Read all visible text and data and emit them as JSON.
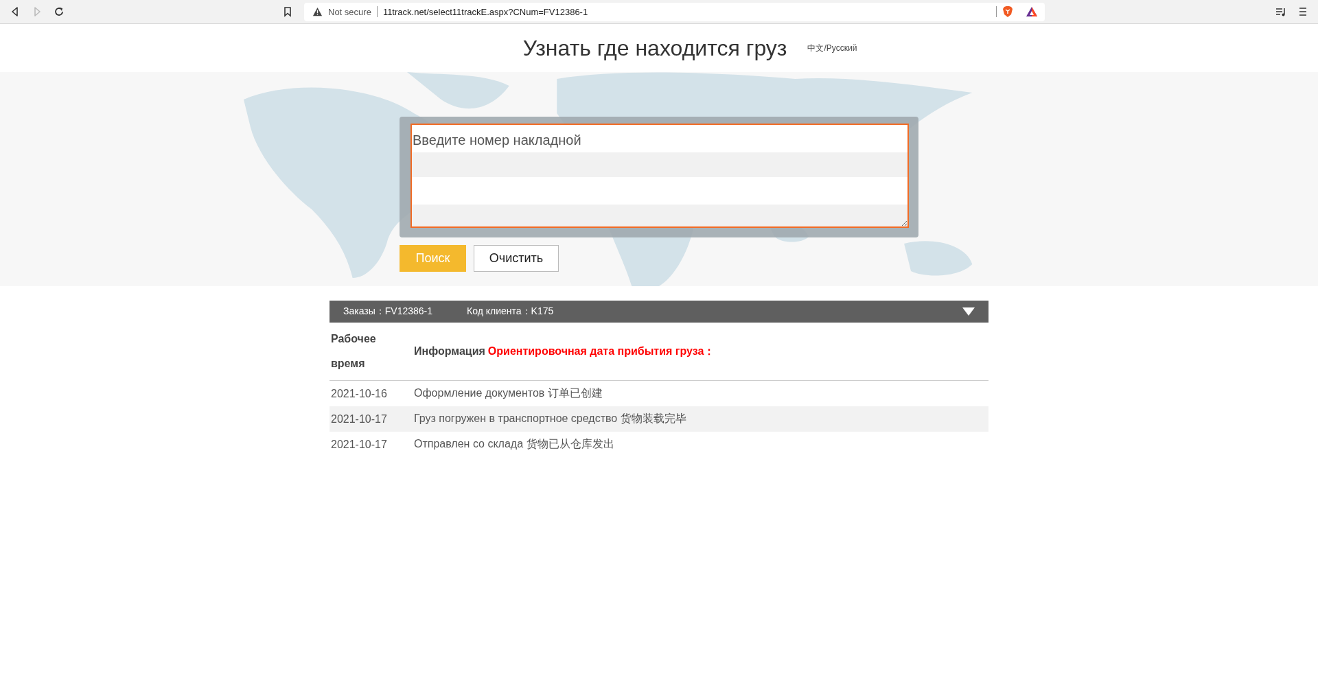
{
  "browser": {
    "security_label": "Not secure",
    "url": "11track.net/select11trackE.aspx?CNum=FV12386-1",
    "forward_disabled": true
  },
  "header": {
    "title": "Узнать где находится груз",
    "language_link": "中文/Русский"
  },
  "search": {
    "placeholder": "Введите номер накладной",
    "buttons": [
      {
        "label": "Поиск",
        "kind": "primary"
      },
      {
        "label": "Очистить",
        "kind": "secondary"
      }
    ]
  },
  "result_bar": {
    "order": "Заказы：FV12386-1",
    "client": "Код клиента：K175",
    "expanded": true
  },
  "table": {
    "columns": [
      {
        "label": "Рабочее время"
      },
      {
        "label": "Информация",
        "note": "Ориентировочная дата прибытия груза："
      }
    ],
    "rows": [
      {
        "date": "2021-10-16",
        "info": "Оформление документов 订单已创建"
      },
      {
        "date": "2021-10-17",
        "info": "Груз погружен в транспортное средство 货物装载完毕"
      },
      {
        "date": "2021-10-17",
        "info": "Отправлен со склада 货物已从仓库发出"
      }
    ]
  }
}
